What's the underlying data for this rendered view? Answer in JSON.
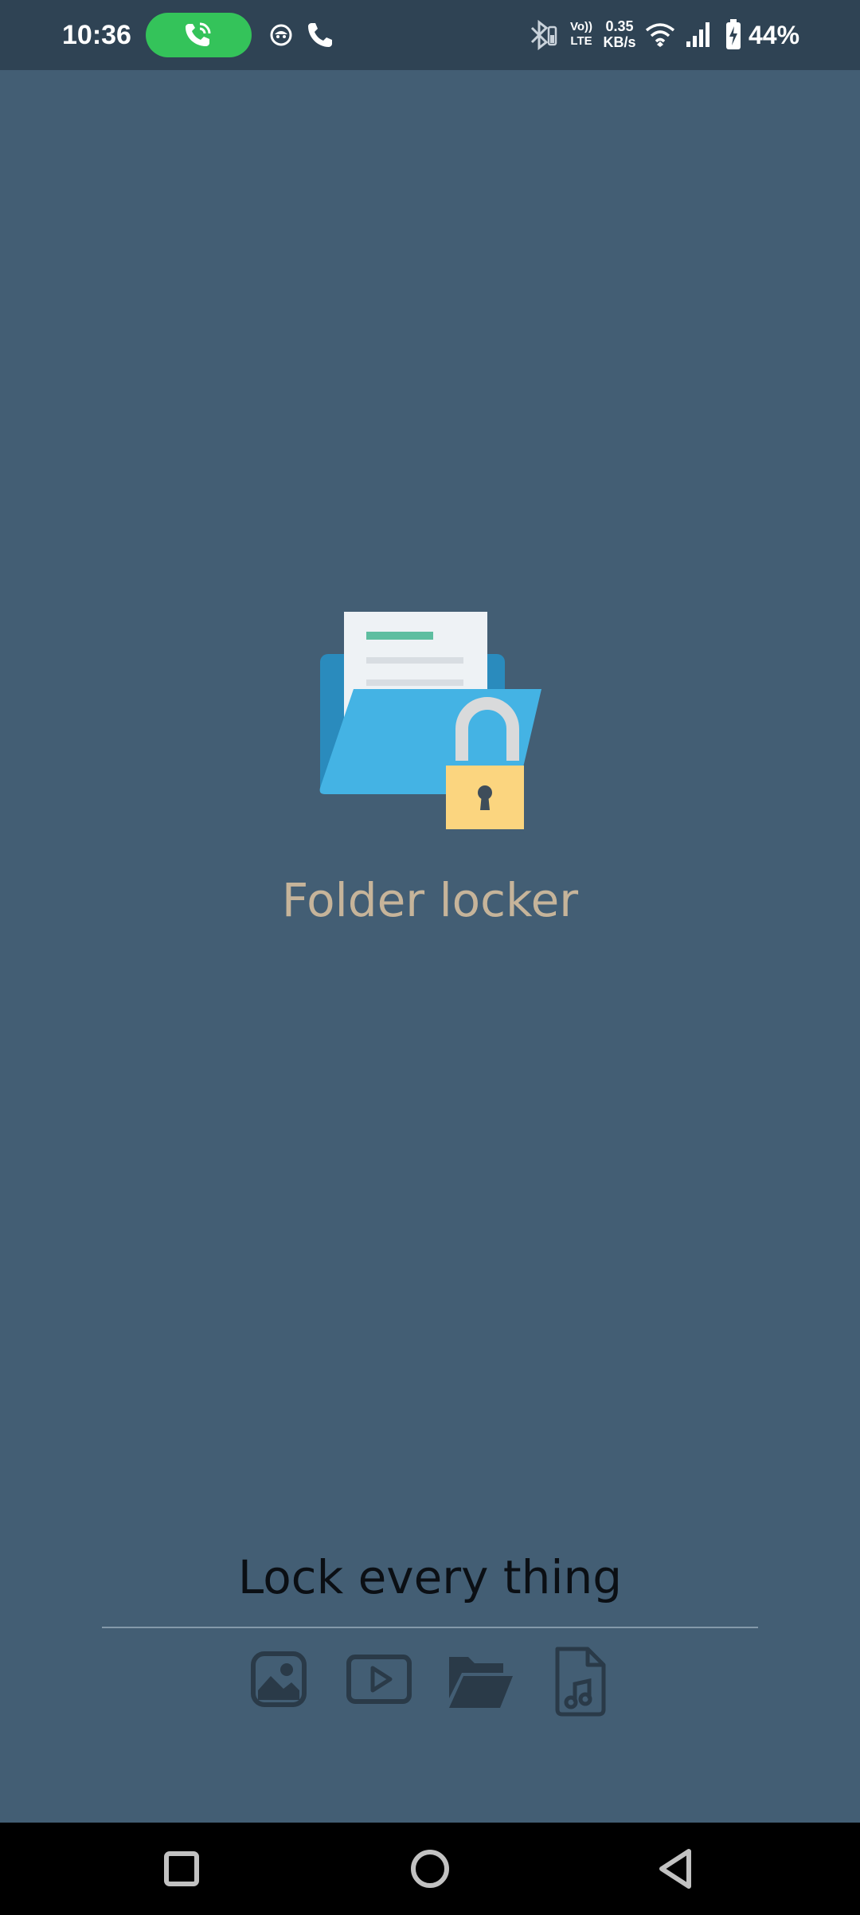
{
  "status_bar": {
    "time": "10:36",
    "volte_top": "Vo))",
    "volte_bottom": "LTE",
    "speed_value": "0.35",
    "speed_unit": "KB/s",
    "battery": "44%",
    "icons": [
      "call-active-icon",
      "alien-notification-icon",
      "phone-icon",
      "bluetooth-icon",
      "wifi-icon",
      "signal-icon",
      "battery-charging-icon"
    ]
  },
  "app": {
    "title": "Folder locker",
    "logo_icon": "locked-folder-icon"
  },
  "footer": {
    "tagline": "Lock every thing",
    "types": [
      {
        "name": "image",
        "icon": "image-icon"
      },
      {
        "name": "video",
        "icon": "video-icon"
      },
      {
        "name": "folder",
        "icon": "folder-open-icon"
      },
      {
        "name": "audio",
        "icon": "audio-file-icon"
      }
    ]
  },
  "nav_bar": {
    "buttons": [
      "recents-icon",
      "home-icon",
      "back-icon"
    ]
  },
  "colors": {
    "background": "#435e74",
    "status_bar": "#2f4354",
    "title": "#c6b49a",
    "tagline": "#0b0f14",
    "footer_icons": "#2a3a48",
    "call_pill": "#34c35a",
    "folder_blue": "#44b3e4",
    "lock_yellow": "#fbd57f"
  }
}
